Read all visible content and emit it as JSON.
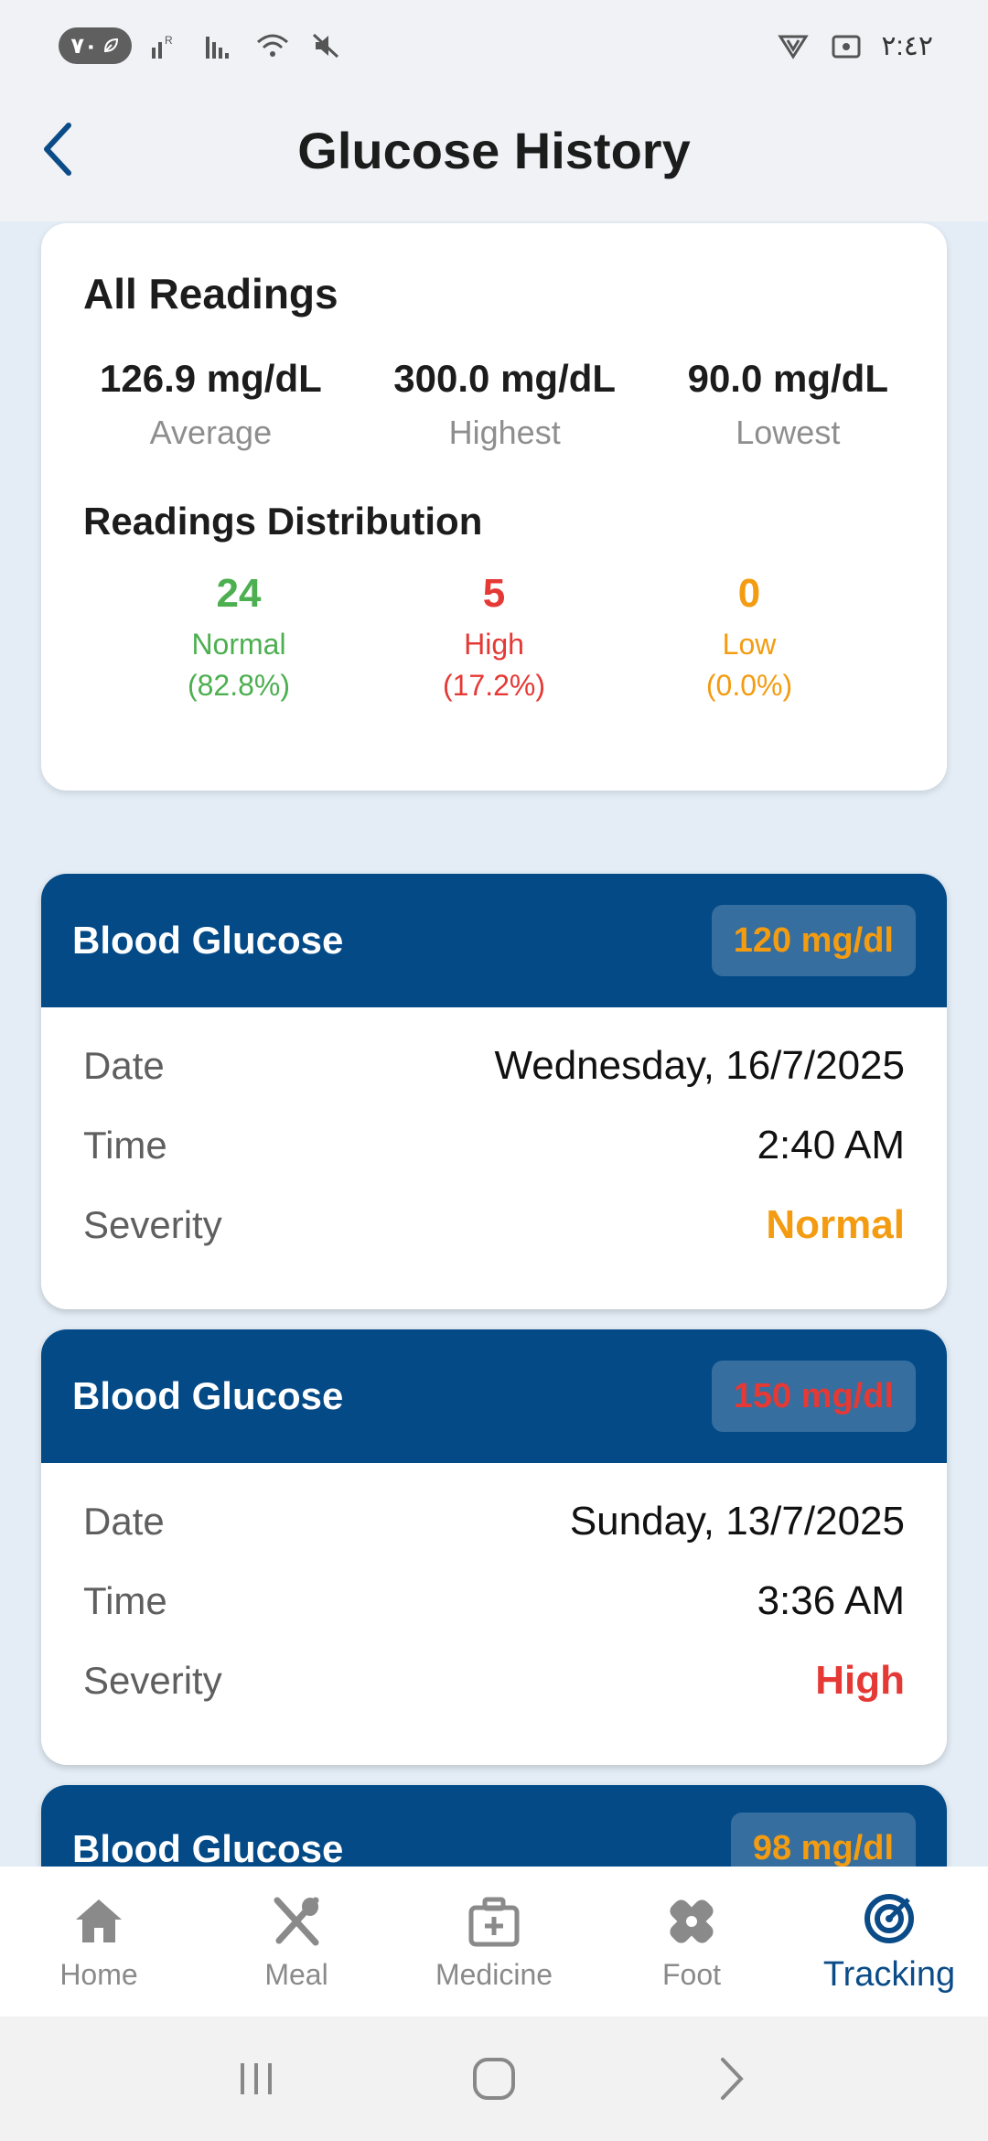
{
  "status_bar": {
    "battery": "٧٠",
    "time": "٢:٤٢"
  },
  "header": {
    "title": "Glucose History"
  },
  "summary": {
    "heading": "All Readings",
    "stats": [
      {
        "value": "126.9 mg/dL",
        "label": "Average"
      },
      {
        "value": "300.0 mg/dL",
        "label": "Highest"
      },
      {
        "value": "90.0 mg/dL",
        "label": "Lowest"
      }
    ],
    "distribution_heading": "Readings Distribution",
    "distribution": [
      {
        "count": "24",
        "label": "Normal",
        "percent": "(82.8%)",
        "color": "#4caf50"
      },
      {
        "count": "5",
        "label": "High",
        "percent": "(17.2%)",
        "color": "#e53935"
      },
      {
        "count": "0",
        "label": "Low",
        "percent": "(0.0%)",
        "color": "#f39c12"
      }
    ]
  },
  "readings": [
    {
      "title": "Blood Glucose",
      "value": "120 mg/dl",
      "value_color": "#f39c12",
      "date_label": "Date",
      "date": "Wednesday, 16/7/2025",
      "time_label": "Time",
      "time": "2:40 AM",
      "severity_label": "Severity",
      "severity": "Normal",
      "severity_color": "#f39c12"
    },
    {
      "title": "Blood Glucose",
      "value": "150 mg/dl",
      "value_color": "#e53935",
      "date_label": "Date",
      "date": "Sunday, 13/7/2025",
      "time_label": "Time",
      "time": "3:36 AM",
      "severity_label": "Severity",
      "severity": "High",
      "severity_color": "#e53935"
    },
    {
      "title": "Blood Glucose",
      "value": "98 mg/dl",
      "value_color": "#f39c12"
    }
  ],
  "bottom_nav": {
    "items": [
      {
        "label": "Home",
        "icon": "home-icon"
      },
      {
        "label": "Meal",
        "icon": "utensils-icon"
      },
      {
        "label": "Medicine",
        "icon": "medical-kit-icon"
      },
      {
        "label": "Foot",
        "icon": "bandage-icon"
      },
      {
        "label": "Tracking",
        "icon": "target-icon",
        "active": true
      }
    ],
    "active_color": "#0b4c88",
    "inactive_color": "#8a8a8a"
  },
  "colors": {
    "primary": "#034a87",
    "background": "#e4edf6",
    "normal": "#4caf50",
    "high": "#e53935",
    "low": "#f39c12"
  }
}
